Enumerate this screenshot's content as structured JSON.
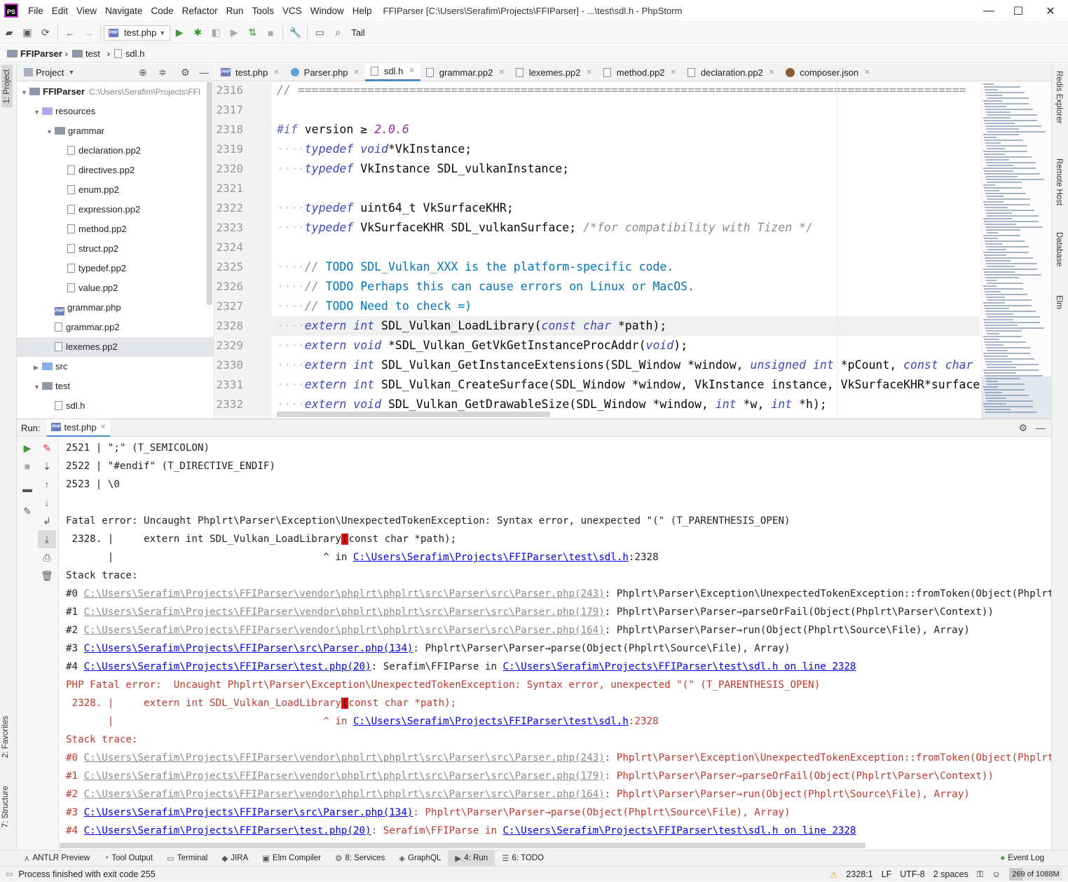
{
  "window": {
    "title": "FFIParser [C:\\Users\\Serafim\\Projects\\FFIParser] - ...\\test\\sdl.h - PhpStorm",
    "logo": "PS",
    "minimize": "—",
    "maximize": "☐",
    "close": "✕"
  },
  "menu": [
    "File",
    "Edit",
    "View",
    "Navigate",
    "Code",
    "Refactor",
    "Run",
    "Tools",
    "VCS",
    "Window",
    "Help"
  ],
  "toolbar": {
    "run_config": "test.php",
    "tail_label": "Tail"
  },
  "breadcrumbs": [
    "FFIParser",
    "test",
    "sdl.h"
  ],
  "left_stripe": {
    "project": "1: Project",
    "favorites": "2: Favorites",
    "structure": "7: Structure"
  },
  "right_stripe": [
    "Redis Explorer",
    "Remote Host",
    "Database",
    "Elm"
  ],
  "project_panel": {
    "title": "Project",
    "tree": [
      {
        "label": "FFIParser",
        "path": "C:\\Users\\Serafim\\Projects\\FFI",
        "depth": 0,
        "kind": "folder",
        "open": true,
        "bold": true
      },
      {
        "label": "resources",
        "depth": 1,
        "kind": "folder-purple",
        "open": true
      },
      {
        "label": "grammar",
        "depth": 2,
        "kind": "folder",
        "open": true
      },
      {
        "label": "declaration.pp2",
        "depth": 3,
        "kind": "file"
      },
      {
        "label": "directives.pp2",
        "depth": 3,
        "kind": "file"
      },
      {
        "label": "enum.pp2",
        "depth": 3,
        "kind": "file"
      },
      {
        "label": "expression.pp2",
        "depth": 3,
        "kind": "file"
      },
      {
        "label": "method.pp2",
        "depth": 3,
        "kind": "file"
      },
      {
        "label": "struct.pp2",
        "depth": 3,
        "kind": "file"
      },
      {
        "label": "typedef.pp2",
        "depth": 3,
        "kind": "file"
      },
      {
        "label": "value.pp2",
        "depth": 3,
        "kind": "file"
      },
      {
        "label": "grammar.php",
        "depth": 2,
        "kind": "php"
      },
      {
        "label": "grammar.pp2",
        "depth": 2,
        "kind": "file"
      },
      {
        "label": "lexemes.pp2",
        "depth": 2,
        "kind": "file",
        "selected": true
      },
      {
        "label": "src",
        "depth": 1,
        "kind": "folder-blue",
        "open": false
      },
      {
        "label": "test",
        "depth": 1,
        "kind": "folder",
        "open": true
      },
      {
        "label": "sdl.h",
        "depth": 2,
        "kind": "file"
      }
    ]
  },
  "editor_tabs": [
    {
      "label": "test.php",
      "icon": "php"
    },
    {
      "label": "Parser.php",
      "icon": "class"
    },
    {
      "label": "sdl.h",
      "icon": "file",
      "active": true
    },
    {
      "label": "grammar.pp2",
      "icon": "file"
    },
    {
      "label": "lexemes.pp2",
      "icon": "file"
    },
    {
      "label": "method.pp2",
      "icon": "file"
    },
    {
      "label": "declaration.pp2",
      "icon": "file"
    },
    {
      "label": "composer.json",
      "icon": "composer"
    }
  ],
  "editor": {
    "line_numbers": [
      "2316",
      "2317",
      "2318",
      "2319",
      "2320",
      "2321",
      "2322",
      "2323",
      "2324",
      "2325",
      "2326",
      "2327",
      "2328",
      "2329",
      "2330",
      "2331",
      "2332"
    ],
    "current_line": "2328",
    "lines": [
      [
        {
          "t": "// ================================================================================================",
          "c": "cm"
        }
      ],
      [],
      [
        {
          "t": "#if",
          "c": "pp"
        },
        {
          "t": " version ≥ ",
          "c": ""
        },
        {
          "t": "2.0.6",
          "c": "num"
        }
      ],
      [
        {
          "t": "····",
          "c": "dots"
        },
        {
          "t": "typedef",
          "c": "kw"
        },
        {
          "t": " ",
          "c": ""
        },
        {
          "t": "void",
          "c": "kw"
        },
        {
          "t": "*VkInstance;",
          "c": ""
        }
      ],
      [
        {
          "t": "····",
          "c": "dots"
        },
        {
          "t": "typedef",
          "c": "kw"
        },
        {
          "t": " VkInstance SDL_vulkanInstance;",
          "c": ""
        }
      ],
      [],
      [
        {
          "t": "····",
          "c": "dots"
        },
        {
          "t": "typedef",
          "c": "kw"
        },
        {
          "t": " uint64_t VkSurfaceKHR;",
          "c": ""
        }
      ],
      [
        {
          "t": "····",
          "c": "dots"
        },
        {
          "t": "typedef",
          "c": "kw"
        },
        {
          "t": " VkSurfaceKHR SDL_vulkanSurface; ",
          "c": ""
        },
        {
          "t": "/*for compatibility with Tizen */",
          "c": "cm"
        }
      ],
      [],
      [
        {
          "t": "····",
          "c": "dots"
        },
        {
          "t": "// ",
          "c": "cm"
        },
        {
          "t": "TODO SDL_Vulkan_XXX is the platform-specific code.",
          "c": "todo"
        }
      ],
      [
        {
          "t": "····",
          "c": "dots"
        },
        {
          "t": "// ",
          "c": "cm"
        },
        {
          "t": "TODO Perhaps this can cause errors on Linux or MacOS.",
          "c": "todo"
        }
      ],
      [
        {
          "t": "····",
          "c": "dots"
        },
        {
          "t": "// ",
          "c": "cm"
        },
        {
          "t": "TODO Need to check =)",
          "c": "todo"
        }
      ],
      [
        {
          "t": "····",
          "c": "dots"
        },
        {
          "t": "extern",
          "c": "kw"
        },
        {
          "t": " ",
          "c": ""
        },
        {
          "t": "int",
          "c": "kw"
        },
        {
          "t": " SDL_Vulkan_LoadLibrary(",
          "c": ""
        },
        {
          "t": "const",
          "c": "kw"
        },
        {
          "t": " ",
          "c": ""
        },
        {
          "t": "char",
          "c": "kw"
        },
        {
          "t": " *path);",
          "c": ""
        }
      ],
      [
        {
          "t": "····",
          "c": "dots"
        },
        {
          "t": "extern",
          "c": "kw"
        },
        {
          "t": " ",
          "c": ""
        },
        {
          "t": "void",
          "c": "kw"
        },
        {
          "t": " *SDL_Vulkan_GetVkGetInstanceProcAddr(",
          "c": ""
        },
        {
          "t": "void",
          "c": "kw"
        },
        {
          "t": ");",
          "c": ""
        }
      ],
      [
        {
          "t": "····",
          "c": "dots"
        },
        {
          "t": "extern",
          "c": "kw"
        },
        {
          "t": " ",
          "c": ""
        },
        {
          "t": "int",
          "c": "kw"
        },
        {
          "t": " SDL_Vulkan_GetInstanceExtensions(SDL_Window *window, ",
          "c": ""
        },
        {
          "t": "unsigned",
          "c": "kw"
        },
        {
          "t": " ",
          "c": ""
        },
        {
          "t": "int",
          "c": "kw"
        },
        {
          "t": " *pCount, ",
          "c": ""
        },
        {
          "t": "const",
          "c": "kw"
        },
        {
          "t": " ",
          "c": ""
        },
        {
          "t": "char",
          "c": "kw"
        }
      ],
      [
        {
          "t": "····",
          "c": "dots"
        },
        {
          "t": "extern",
          "c": "kw"
        },
        {
          "t": " ",
          "c": ""
        },
        {
          "t": "int",
          "c": "kw"
        },
        {
          "t": " SDL_Vulkan_CreateSurface(SDL_Window *window, VkInstance instance, VkSurfaceKHR*surface",
          "c": ""
        }
      ],
      [
        {
          "t": "····",
          "c": "dots"
        },
        {
          "t": "extern",
          "c": "kw"
        },
        {
          "t": " ",
          "c": ""
        },
        {
          "t": "void",
          "c": "kw"
        },
        {
          "t": " SDL_Vulkan_GetDrawableSize(SDL_Window *window, ",
          "c": ""
        },
        {
          "t": "int",
          "c": "kw"
        },
        {
          "t": " *w, ",
          "c": ""
        },
        {
          "t": "int",
          "c": "kw"
        },
        {
          "t": " *h);",
          "c": ""
        }
      ]
    ]
  },
  "run_panel": {
    "label": "Run:",
    "tab": "test.php",
    "output": [
      {
        "segs": [
          {
            "t": "2521 | \";\" (T_SEMICOLON)"
          }
        ]
      },
      {
        "segs": [
          {
            "t": "2522 | \"#endif\" (T_DIRECTIVE_ENDIF)"
          }
        ]
      },
      {
        "segs": [
          {
            "t": "2523 | \\0"
          }
        ]
      },
      {
        "segs": [
          {
            "t": ""
          }
        ]
      },
      {
        "segs": [
          {
            "t": "Fatal error: Uncaught Phplrt\\Parser\\Exception\\UnexpectedTokenException: Syntax error, unexpected \"(\" (T_PARENTHESIS_OPEN)"
          }
        ]
      },
      {
        "segs": [
          {
            "t": " 2328. |     extern int SDL_Vulkan_LoadLibrary"
          },
          {
            "t": "(",
            "k": "caret"
          },
          {
            "t": "const char *path);"
          }
        ]
      },
      {
        "segs": [
          {
            "t": "       |                                   ^ in "
          },
          {
            "t": "C:\\Users\\Serafim\\Projects\\FFIParser\\test\\sdl.h",
            "k": "link"
          },
          {
            "t": ":2328"
          }
        ]
      },
      {
        "segs": [
          {
            "t": "Stack trace:"
          }
        ]
      },
      {
        "segs": [
          {
            "t": "#0 "
          },
          {
            "t": "C:\\Users\\Serafim\\Projects\\FFIParser\\vendor\\phplrt\\phplrt\\src\\Parser\\src\\Parser.php(243)",
            "k": "grey"
          },
          {
            "t": ": Phplrt\\Parser\\Exception\\UnexpectedTokenException::fromToken(Object(Phplrt\\Source\\Fil"
          }
        ]
      },
      {
        "segs": [
          {
            "t": "#1 "
          },
          {
            "t": "C:\\Users\\Serafim\\Projects\\FFIParser\\vendor\\phplrt\\phplrt\\src\\Parser\\src\\Parser.php(179)",
            "k": "grey"
          },
          {
            "t": ": Phplrt\\Parser\\Parser→parseOrFail(Object(Phplrt\\Parser\\Context))"
          }
        ]
      },
      {
        "segs": [
          {
            "t": "#2 "
          },
          {
            "t": "C:\\Users\\Serafim\\Projects\\FFIParser\\vendor\\phplrt\\phplrt\\src\\Parser\\src\\Parser.php(164)",
            "k": "grey"
          },
          {
            "t": ": Phplrt\\Parser\\Parser→run(Object(Phplrt\\Source\\File), Array)"
          }
        ]
      },
      {
        "segs": [
          {
            "t": "#3 "
          },
          {
            "t": "C:\\Users\\Serafim\\Projects\\FFIParser\\src\\Parser.php(134)",
            "k": "link"
          },
          {
            "t": ": Phplrt\\Parser\\Parser→parse(Object(Phplrt\\Source\\File), Array)"
          }
        ]
      },
      {
        "segs": [
          {
            "t": "#4 "
          },
          {
            "t": "C:\\Users\\Serafim\\Projects\\FFIParser\\test.php(20)",
            "k": "link"
          },
          {
            "t": ": Serafim\\FFIParse in "
          },
          {
            "t": "C:\\Users\\Serafim\\Projects\\FFIParser\\test\\sdl.h on line 2328",
            "k": "link"
          }
        ]
      },
      {
        "err": true,
        "segs": [
          {
            "t": "PHP Fatal error:  Uncaught Phplrt\\Parser\\Exception\\UnexpectedTokenException: Syntax error, unexpected \"(\" (T_PARENTHESIS_OPEN)"
          }
        ]
      },
      {
        "err": true,
        "segs": [
          {
            "t": " 2328. |     extern int SDL_Vulkan_LoadLibrary"
          },
          {
            "t": "(",
            "k": "caret"
          },
          {
            "t": "const char *path);"
          }
        ]
      },
      {
        "err": true,
        "segs": [
          {
            "t": "       |                                   ^ in "
          },
          {
            "t": "C:\\Users\\Serafim\\Projects\\FFIParser\\test\\sdl.h",
            "k": "link"
          },
          {
            "t": ":2328"
          }
        ]
      },
      {
        "err": true,
        "segs": [
          {
            "t": "Stack trace:"
          }
        ]
      },
      {
        "err": true,
        "segs": [
          {
            "t": "#0 "
          },
          {
            "t": "C:\\Users\\Serafim\\Projects\\FFIParser\\vendor\\phplrt\\phplrt\\src\\Parser\\src\\Parser.php(243)",
            "k": "grey"
          },
          {
            "t": ": Phplrt\\Parser\\Exception\\UnexpectedTokenException::fromToken(Object(Phplrt\\Source\\Fil"
          }
        ]
      },
      {
        "err": true,
        "segs": [
          {
            "t": "#1 "
          },
          {
            "t": "C:\\Users\\Serafim\\Projects\\FFIParser\\vendor\\phplrt\\phplrt\\src\\Parser\\src\\Parser.php(179)",
            "k": "grey"
          },
          {
            "t": ": Phplrt\\Parser\\Parser→parseOrFail(Object(Phplrt\\Parser\\Context))"
          }
        ]
      },
      {
        "err": true,
        "segs": [
          {
            "t": "#2 "
          },
          {
            "t": "C:\\Users\\Serafim\\Projects\\FFIParser\\vendor\\phplrt\\phplrt\\src\\Parser\\src\\Parser.php(164)",
            "k": "grey"
          },
          {
            "t": ": Phplrt\\Parser\\Parser→run(Object(Phplrt\\Source\\File), Array)"
          }
        ]
      },
      {
        "err": true,
        "segs": [
          {
            "t": "#3 "
          },
          {
            "t": "C:\\Users\\Serafim\\Projects\\FFIParser\\src\\Parser.php(134)",
            "k": "link"
          },
          {
            "t": ": Phplrt\\Parser\\Parser→parse(Object(Phplrt\\Source\\File), Array)"
          }
        ]
      },
      {
        "err": true,
        "segs": [
          {
            "t": "#4 "
          },
          {
            "t": "C:\\Users\\Serafim\\Projects\\FFIParser\\test.php(20)",
            "k": "link"
          },
          {
            "t": ": Serafim\\FFIParse in "
          },
          {
            "t": "C:\\Users\\Serafim\\Projects\\FFIParser\\test\\sdl.h on line 2328",
            "k": "link"
          }
        ]
      }
    ]
  },
  "bottom_tools": [
    {
      "label": "ANTLR Preview"
    },
    {
      "label": "Tool Output"
    },
    {
      "label": "Terminal"
    },
    {
      "label": "JIRA"
    },
    {
      "label": "Elm Compiler"
    },
    {
      "label": "8: Services"
    },
    {
      "label": "GraphQL"
    },
    {
      "label": "4: Run",
      "active": true
    },
    {
      "label": "6: TODO"
    }
  ],
  "event_log": "Event Log",
  "status": {
    "message": "Process finished with exit code 255",
    "position": "2328:1",
    "line_sep": "LF",
    "encoding": "UTF-8",
    "indent": "2 spaces",
    "memory": "269 of 1088M",
    "memory_fraction": 0.25
  },
  "colors": {
    "accent": "#4a88c7",
    "error": "#c0392b",
    "link": "#0000ee",
    "keyword": "#3b47c0",
    "todo": "#0073bf"
  }
}
